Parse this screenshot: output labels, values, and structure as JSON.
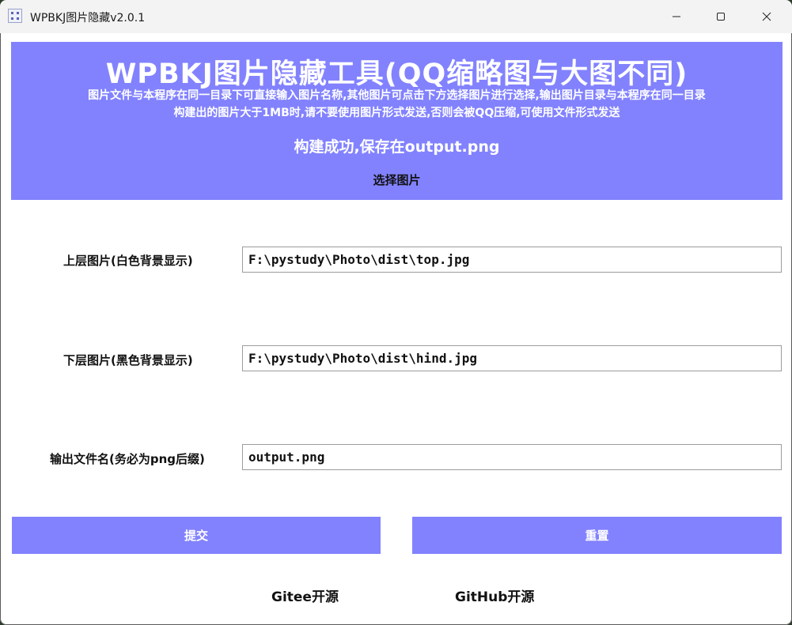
{
  "window": {
    "title": "WPBKJ图片隐藏v2.0.1"
  },
  "banner": {
    "title": "WPBKJ图片隐藏工具(QQ缩略图与大图不同)",
    "line1": "图片文件与本程序在同一目录下可直接输入图片名称,其他图片可点击下方选择图片进行选择,输出图片目录与本程序在同一目录",
    "line2": "构建出的图片大于1MB时,请不要使用图片形式发送,否则会被QQ压缩,可使用文件形式发送",
    "status": "构建成功,保存在output.png",
    "choose_label": "选择图片"
  },
  "form": {
    "top_label": "上层图片(白色背景显示)",
    "top_value": "F:\\pystudy\\Photo\\dist\\top.jpg",
    "bottom_label": "下层图片(黑色背景显示)",
    "bottom_value": "F:\\pystudy\\Photo\\dist\\hind.jpg",
    "output_label": "输出文件名(务必为png后缀)",
    "output_value": "output.png"
  },
  "buttons": {
    "submit": "提交",
    "reset": "重置"
  },
  "links": {
    "gitee": "Gitee开源",
    "github": "GitHub开源"
  },
  "colors": {
    "accent": "#8282ff",
    "titlebar": "#f3f3f3"
  }
}
